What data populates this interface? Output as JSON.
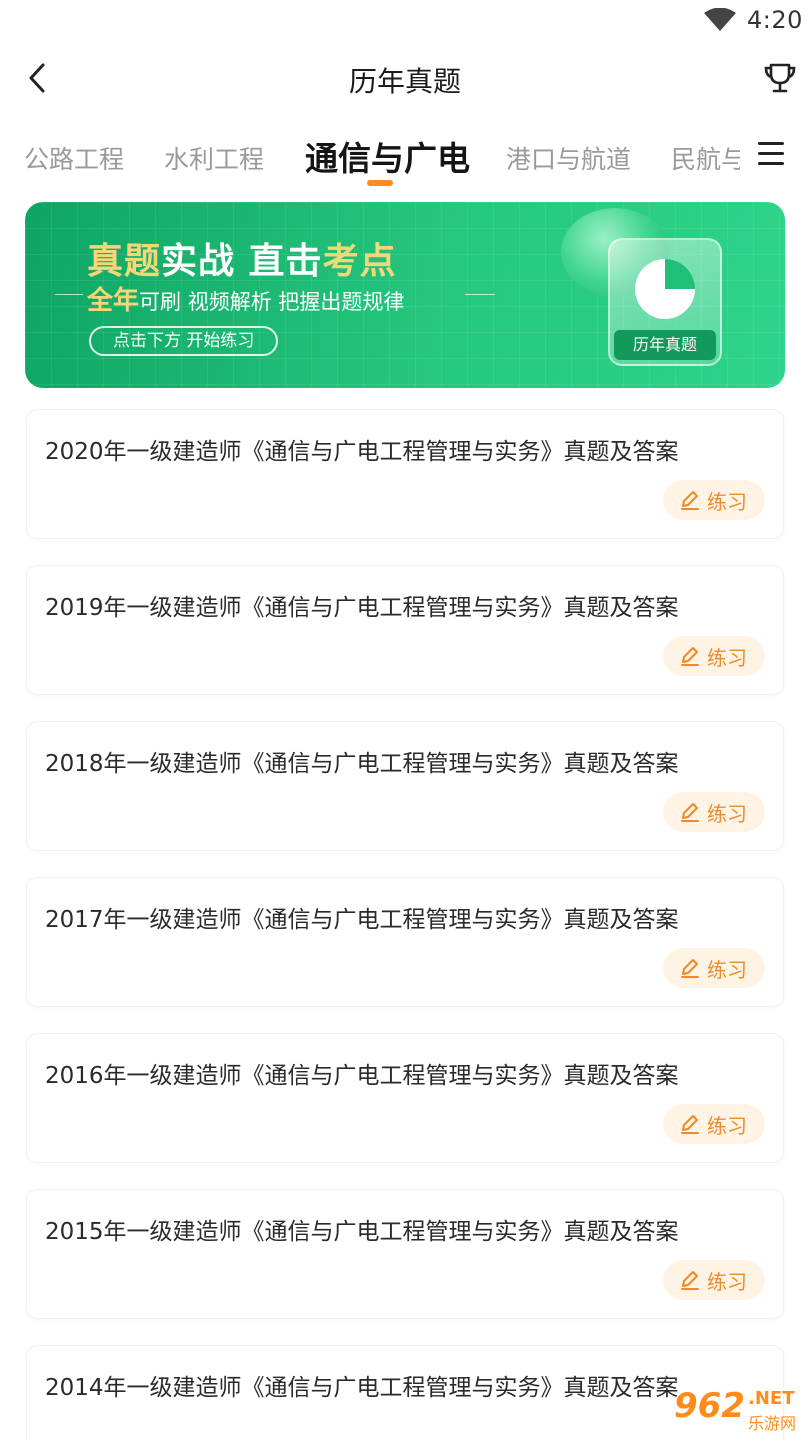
{
  "status_bar": {
    "time": "4:20"
  },
  "header": {
    "title": "历年真题"
  },
  "tabs": [
    {
      "label": "公路工程"
    },
    {
      "label": "水利工程"
    },
    {
      "label": "通信与广电"
    },
    {
      "label": "港口与航道"
    },
    {
      "label": "民航与"
    }
  ],
  "banner": {
    "headline_a": "真题",
    "headline_b": "实战 直击",
    "headline_c": "考点",
    "sub_a": "全年",
    "sub_b": "可刷 视频解析 把握出题规律",
    "cta": "点击下方 开始练习",
    "card_label": "历年真题"
  },
  "list": {
    "practice_label": "练习",
    "items": [
      {
        "title": "2020年一级建造师《通信与广电工程管理与实务》真题及答案"
      },
      {
        "title": "2019年一级建造师《通信与广电工程管理与实务》真题及答案"
      },
      {
        "title": "2018年一级建造师《通信与广电工程管理与实务》真题及答案"
      },
      {
        "title": "2017年一级建造师《通信与广电工程管理与实务》真题及答案"
      },
      {
        "title": "2016年一级建造师《通信与广电工程管理与实务》真题及答案"
      },
      {
        "title": "2015年一级建造师《通信与广电工程管理与实务》真题及答案"
      },
      {
        "title": "2014年一级建造师《通信与广电工程管理与实务》真题及答案"
      }
    ]
  },
  "watermark": {
    "num": "962",
    "net": ".NET",
    "cn": "乐游网"
  },
  "colors": {
    "accent": "#ff8a1f",
    "banner_green": "#1fbf77",
    "practice_bg": "#fff3e6",
    "practice_text": "#f08a24"
  }
}
